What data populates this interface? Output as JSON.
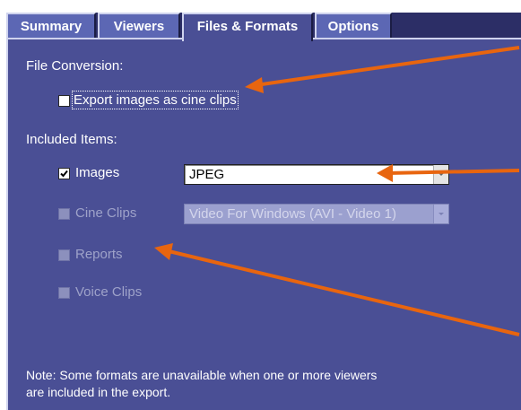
{
  "tabs": [
    {
      "label": "Summary",
      "active": false
    },
    {
      "label": "Viewers",
      "active": false
    },
    {
      "label": "Files & Formats",
      "active": true
    },
    {
      "label": "Options",
      "active": false
    }
  ],
  "file_conversion": {
    "heading": "File Conversion:",
    "export_cine": {
      "label": "Export images as cine clips",
      "checked": false
    }
  },
  "included_items": {
    "heading": "Included Items:",
    "images": {
      "label": "Images",
      "checked": true,
      "format": "JPEG"
    },
    "cine_clips": {
      "label": "Cine Clips",
      "checked": false,
      "format": "Video For Windows (AVI - Video 1)"
    },
    "reports": {
      "label": "Reports",
      "checked": false
    },
    "voice_clips": {
      "label": "Voice Clips",
      "checked": false
    }
  },
  "note": {
    "line1": "Note: Some formats are unavailable when one or more viewers",
    "line2": "are included in the export."
  },
  "colors": {
    "panel_bg": "#4a4f95",
    "tab_bg": "#5c67b4",
    "tabbar_bg": "#2c2e66",
    "annotation_arrow": "#e8650f"
  },
  "icons": {
    "checkmark": "check-icon",
    "dropdown": "chevron-down-icon",
    "annotation": "arrow-icon"
  }
}
